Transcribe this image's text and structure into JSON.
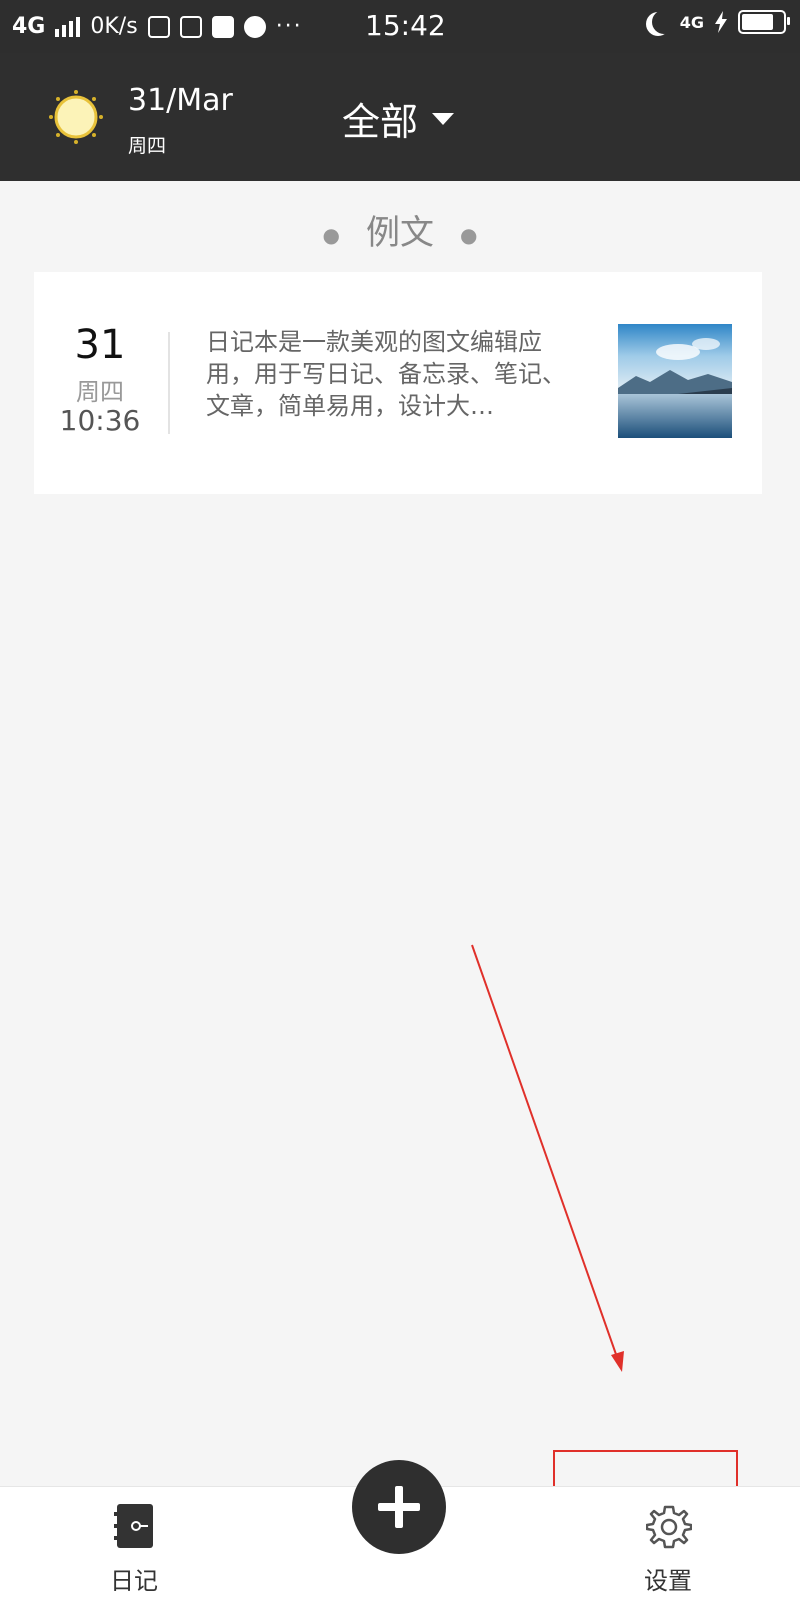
{
  "status_bar": {
    "network": "4G",
    "speed": "0K/s",
    "time": "15:42",
    "right_network": "4G",
    "icons": [
      "signal-icon",
      "wifi-calling-icon",
      "app-icon",
      "message-icon",
      "planet-icon",
      "more-icon",
      "moon-icon",
      "charging-icon",
      "battery-icon"
    ],
    "battery_level": 0.85
  },
  "header": {
    "date": "31/Mar",
    "weekday": "周四",
    "filter_label": "全部",
    "weather_icon": "sun-icon"
  },
  "section": {
    "title": "例文"
  },
  "entries": [
    {
      "day": "31",
      "weekday": "周四",
      "time": "10:36",
      "text": "日记本是一款美观的图文编辑应用，用于写日记、备忘录、笔记、文章，简单易用，设计大…",
      "thumbnail": "lake-landscape"
    }
  ],
  "bottom_nav": {
    "diary_label": "日记",
    "settings_label": "设置",
    "add_icon": "plus-icon"
  },
  "colors": {
    "header_bg": "#2f2f2f",
    "annotation": "#e0302a",
    "page_bg": "#f5f5f5"
  }
}
